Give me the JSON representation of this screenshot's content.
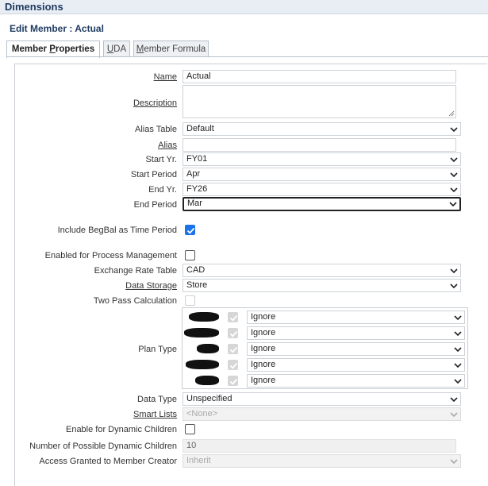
{
  "window": {
    "title": "Dimensions"
  },
  "header": {
    "subtitle": "Edit Member : Actual"
  },
  "tabs": [
    {
      "label_pre": "Member ",
      "label_u": "P",
      "label_post": "roperties"
    },
    {
      "label_pre": "",
      "label_u": "U",
      "label_post": "DA"
    },
    {
      "label_pre": "",
      "label_u": "M",
      "label_post": "ember Formula"
    }
  ],
  "form": {
    "name": {
      "label": "Name",
      "value": "Actual"
    },
    "description": {
      "label": "Description",
      "value": ""
    },
    "alias_table": {
      "label": "Alias Table",
      "value": "Default"
    },
    "alias": {
      "label": "Alias",
      "value": ""
    },
    "start_yr": {
      "label": "Start Yr.",
      "value": "FY01"
    },
    "start_period": {
      "label": "Start Period",
      "value": "Apr"
    },
    "end_yr": {
      "label": "End Yr.",
      "value": "FY26"
    },
    "end_period": {
      "label": "End Period",
      "value": "Mar"
    },
    "include_begbal": {
      "label": "Include BegBal as Time Period",
      "checked": true
    },
    "process_mgmt": {
      "label": "Enabled for Process Management",
      "checked": false
    },
    "exchange_rate": {
      "label": "Exchange Rate Table",
      "value": "CAD"
    },
    "data_storage": {
      "label": "Data Storage",
      "value": "Store"
    },
    "two_pass": {
      "label": "Two Pass Calculation",
      "checked": false
    },
    "plan_type": {
      "label": "Plan Type",
      "rows": [
        {
          "value": "Ignore"
        },
        {
          "value": "Ignore"
        },
        {
          "value": "Ignore"
        },
        {
          "value": "Ignore"
        },
        {
          "value": "Ignore"
        }
      ]
    },
    "data_type": {
      "label": "Data Type",
      "value": "Unspecified"
    },
    "smart_lists": {
      "label": "Smart Lists",
      "value": "<None>"
    },
    "dynamic_children": {
      "label": "Enable for Dynamic Children",
      "checked": false
    },
    "num_dynamic": {
      "label": "Number of Possible Dynamic Children",
      "value": "10"
    },
    "access_granted": {
      "label": "Access Granted to Member Creator",
      "value": "Inherit"
    }
  },
  "colors": {
    "accent": "#1a73e8",
    "title": "#1e3a5f",
    "focus_border": "#222222"
  },
  "icons": [
    "chevron-down-icon",
    "checkmark-icon",
    "resize-handle-icon"
  ]
}
